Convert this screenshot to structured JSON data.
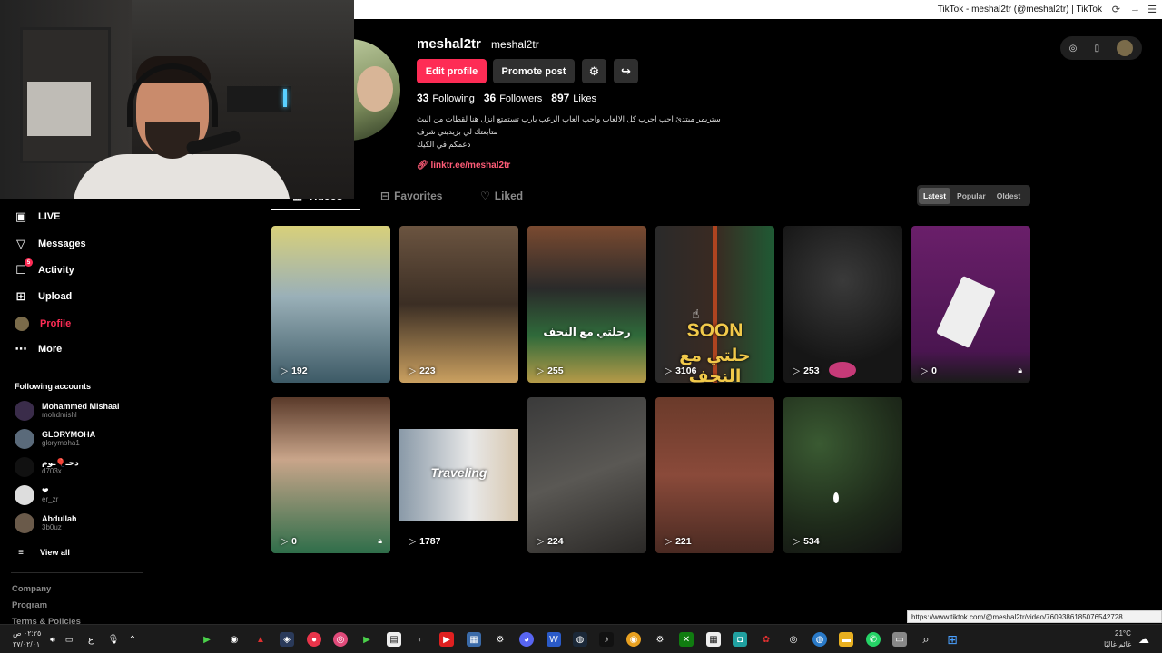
{
  "browser": {
    "title": "TikTok - meshal2tr (@meshal2tr) | TikTok"
  },
  "sidebar": {
    "nav": [
      {
        "label": "LIVE",
        "icon": "live-icon"
      },
      {
        "label": "Messages",
        "icon": "messages-icon"
      },
      {
        "label": "Activity",
        "icon": "activity-icon",
        "badge": "5"
      },
      {
        "label": "Upload",
        "icon": "upload-icon"
      },
      {
        "label": "Profile",
        "icon": "profile-avatar-icon",
        "active": true
      },
      {
        "label": "More",
        "icon": "more-icon"
      }
    ],
    "following_label": "Following accounts",
    "accounts": [
      {
        "name": "Mohammed Mishaal",
        "handle": "mohdmishl"
      },
      {
        "name": "GLORYMOHA",
        "handle": "glorymoha1"
      },
      {
        "name": "دحـ🎈ـوم",
        "handle": "d703x"
      },
      {
        "name": "❤",
        "handle": "er_zr"
      },
      {
        "name": "Abdullah",
        "handle": "3b0uz"
      }
    ],
    "view_all": "View all",
    "footer": [
      "Company",
      "Program",
      "Terms & Policies"
    ]
  },
  "profile": {
    "username": "meshal2tr",
    "nickname": "meshal2tr",
    "edit_label": "Edit profile",
    "promote_label": "Promote post",
    "following_count": "33",
    "following_label": "Following",
    "followers_count": "36",
    "followers_label": "Followers",
    "likes_count": "897",
    "likes_label": "Likes",
    "bio_lines": [
      "ستريمر مبتدئ احب اجرب كل الالعاب واحب العاب الرعب يارب تستمتع انزل هنا لقطات من البث",
      "متابعتك لي بزيديني شرف",
      "دعمكم في الكيك"
    ],
    "link": "linktr.ee/meshal2tr"
  },
  "tabs": {
    "videos": "Videos",
    "favorites": "Favorites",
    "liked": "Liked"
  },
  "sort": {
    "latest": "Latest",
    "popular": "Popular",
    "oldest": "Oldest"
  },
  "videos": [
    {
      "views": "192"
    },
    {
      "views": "223"
    },
    {
      "views": "255",
      "caption": "رحلتي مع النحف"
    },
    {
      "views": "3106",
      "caption_top": "SOON",
      "caption": "حلتي مع النحف"
    },
    {
      "views": "253"
    },
    {
      "views": "0",
      "locked": true
    },
    {
      "views": "0",
      "locked": true
    },
    {
      "views": "1787",
      "caption": "Traveling"
    },
    {
      "views": "224"
    },
    {
      "views": "221"
    },
    {
      "views": "534"
    }
  ],
  "status_url": "https://www.tiktok.com/@meshal2tr/video/7609386185076542728",
  "taskbar": {
    "time": "٠٢:٢٥ ص",
    "date": "٢٧/٠٢/٠١",
    "weather_temp": "21°C",
    "weather_text": "غائم غالبًا",
    "lang": "ع"
  }
}
